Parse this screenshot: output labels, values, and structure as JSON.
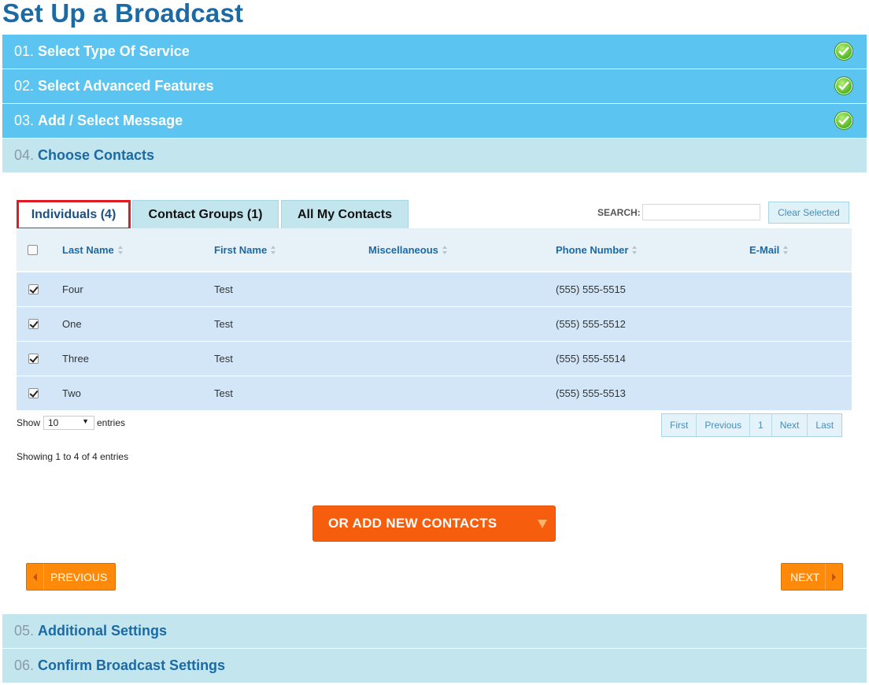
{
  "page_title": "Set Up a Broadcast",
  "steps_done": [
    {
      "num": "01.",
      "label": "Select Type Of Service"
    },
    {
      "num": "02.",
      "label": "Select Advanced Features"
    },
    {
      "num": "03.",
      "label": "Add / Select Message"
    }
  ],
  "current_step": {
    "num": "04.",
    "label": "Choose Contacts"
  },
  "steps_after": [
    {
      "num": "05.",
      "label": "Additional Settings"
    },
    {
      "num": "06.",
      "label": "Confirm Broadcast Settings"
    }
  ],
  "tabs": [
    {
      "label": "Individuals (4)",
      "active": true
    },
    {
      "label": "Contact Groups (1)",
      "active": false
    },
    {
      "label": "All My Contacts",
      "active": false
    }
  ],
  "search": {
    "label": "SEARCH:",
    "value": ""
  },
  "clear_selected_label": "Clear Selected",
  "table": {
    "columns": [
      "Last Name",
      "First Name",
      "Miscellaneous",
      "Phone Number",
      "E-Mail"
    ],
    "rows": [
      {
        "checked": true,
        "last": "Four",
        "first": "Test",
        "misc": "",
        "phone": "(555) 555-5515",
        "email": ""
      },
      {
        "checked": true,
        "last": "One",
        "first": "Test",
        "misc": "",
        "phone": "(555) 555-5512",
        "email": ""
      },
      {
        "checked": true,
        "last": "Three",
        "first": "Test",
        "misc": "",
        "phone": "(555) 555-5514",
        "email": ""
      },
      {
        "checked": true,
        "last": "Two",
        "first": "Test",
        "misc": "",
        "phone": "(555) 555-5513",
        "email": ""
      }
    ]
  },
  "length_menu": {
    "show": "Show",
    "value": "10",
    "entries": "entries"
  },
  "info_text": "Showing 1 to 4 of 4 entries",
  "pagination": [
    "First",
    "Previous",
    "1",
    "Next",
    "Last"
  ],
  "add_contacts_label": "OR ADD NEW CONTACTS",
  "previous_label": "PREVIOUS",
  "next_label": "NEXT",
  "colors": {
    "accent": "#5bc4f1",
    "title": "#1b6aa5",
    "cta": "#f65e0d",
    "nav": "#ff8a0a"
  }
}
